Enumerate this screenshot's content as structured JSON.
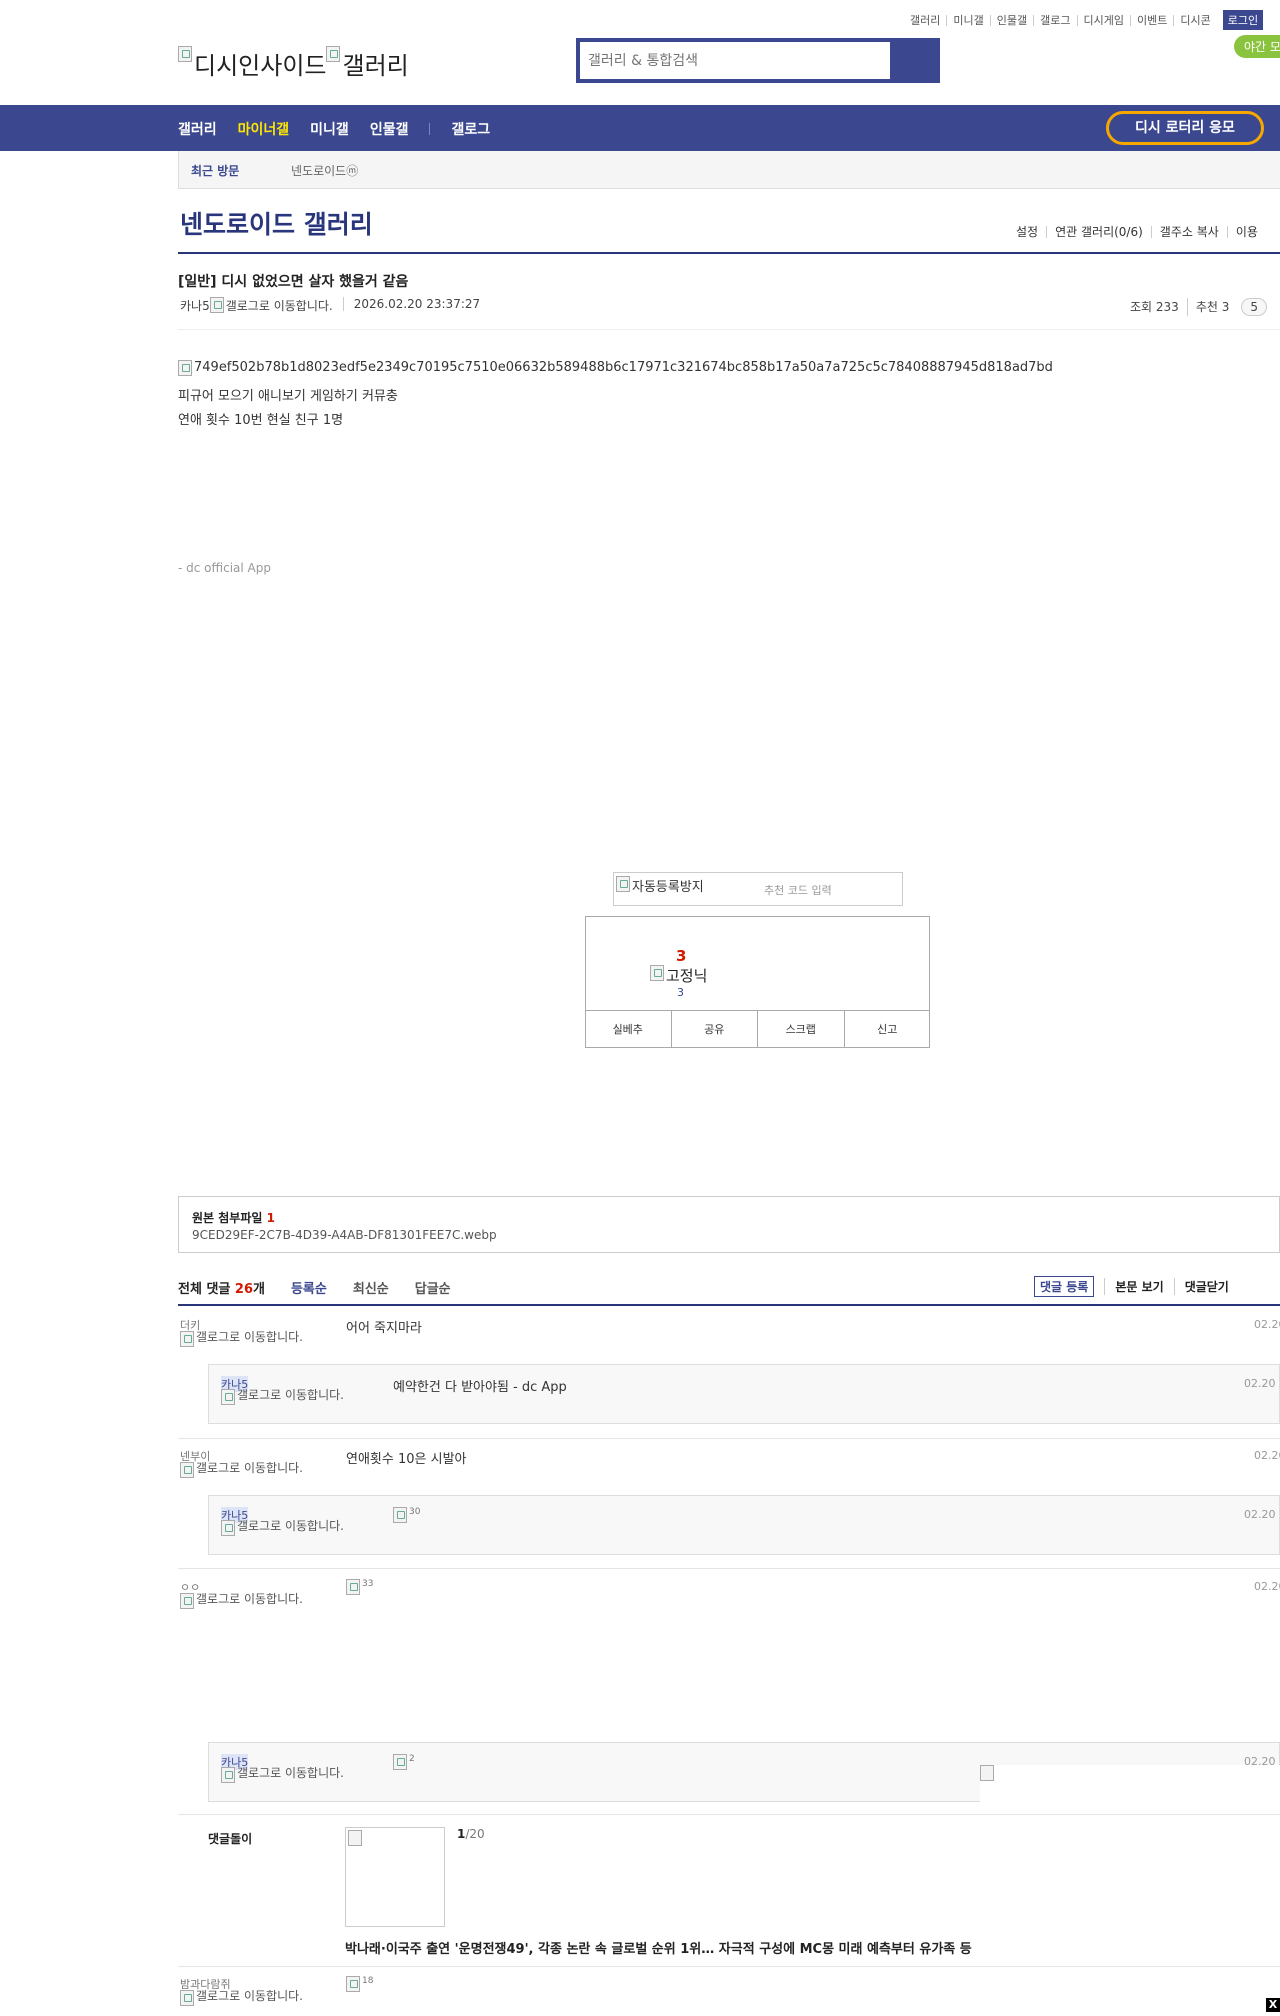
{
  "util": {
    "items": [
      "갤러리",
      "미니갤",
      "인물갤",
      "갤로그",
      "디시게임",
      "이벤트",
      "디시콘"
    ],
    "login": "로그인",
    "night": "야간 모드"
  },
  "header": {
    "logo_alt": "디시인사이드",
    "gallery_alt": "갤러리",
    "search_placeholder": "갤러리 & 통합검색"
  },
  "nav": {
    "items": [
      "갤러리",
      "마이너갤",
      "미니갤",
      "인물갤",
      "갤로그"
    ],
    "lotto": "디시 로터리 응모"
  },
  "recent": {
    "title": "최근 방문",
    "gallery": "넨도로이드ⓜ"
  },
  "gallery": {
    "title": "넨도로이드 갤러리",
    "menu": [
      "설정",
      "연관 갤러리(0/6)",
      "갤주소 복사",
      "이용"
    ]
  },
  "post": {
    "title": "[일반] 디시 없었으면 살자 했을거 같음",
    "author": "카나5",
    "galmove": "갤로그로 이동합니다.",
    "date": "2026.02.20 23:37:27",
    "views": "조회 233",
    "recommend": "추천 3",
    "comment_count": "5",
    "image_alt": "749ef502b78b1d8023edf5e2349c70195c7510e06632b589488b6c17971c321674bc858b17a50a7a725c5c78408887945d818ad7bd",
    "body_line1": "피규어 모으기 애니보기 게임하기 커뮤충",
    "body_line2": "연애 횟수 10번 현실 친구 1명",
    "app_sig": "- dc official App"
  },
  "recommend": {
    "captcha_alt": "자동등록방지",
    "captcha_placeholder": "추천 코드 입력",
    "count": "3",
    "fixed_alt": "고정닉",
    "fixed_count": "3",
    "buttons": [
      "실베추",
      "공유",
      "스크랩",
      "신고"
    ]
  },
  "attach": {
    "title": "원본 첨부파일",
    "count": "1",
    "file": "9CED29EF-2C7B-4D39-A4AB-DF81301FEE7C.webp"
  },
  "comments": {
    "total_label": "전체 댓글",
    "total": "26",
    "unit": "개",
    "sorts": [
      "등록순",
      "최신순",
      "답글순"
    ],
    "actions": [
      "댓글 등록",
      "본문 보기",
      "댓글닫기"
    ],
    "galmove": "갤로그로 이동합니다.",
    "list": [
      {
        "nick": "더키",
        "text": "어어 죽지마라",
        "date": "02.20"
      },
      {
        "nick": "카나5",
        "text": "예약한건 다 받아야됨 - dc App",
        "date": "02.20 2"
      },
      {
        "nick": "넨부이",
        "text": "연애횟수 10은 시발아",
        "date": "02.20"
      },
      {
        "nick": "카나5",
        "text": "",
        "img_alt": "30",
        "date": "02.20 2"
      },
      {
        "nick": "ㅇㅇ",
        "text": "",
        "img_alt": "33",
        "date": "02.20"
      },
      {
        "nick": "카나5",
        "text": "",
        "img_alt": "2",
        "date": "02.20 2"
      },
      {
        "nick": "밤과다람쥐",
        "text": "",
        "img_alt": "18",
        "date": ""
      }
    ]
  },
  "dolly": {
    "title": "댓글돌이",
    "page": "1",
    "total": "/20",
    "news": "박나래·이국주 출연 '운명전쟁49', 각종 논란 속 글로벌 순위 1위… 자극적 구성에 MC몽 미래 예측부터 유가족 등"
  },
  "close_label": "X"
}
